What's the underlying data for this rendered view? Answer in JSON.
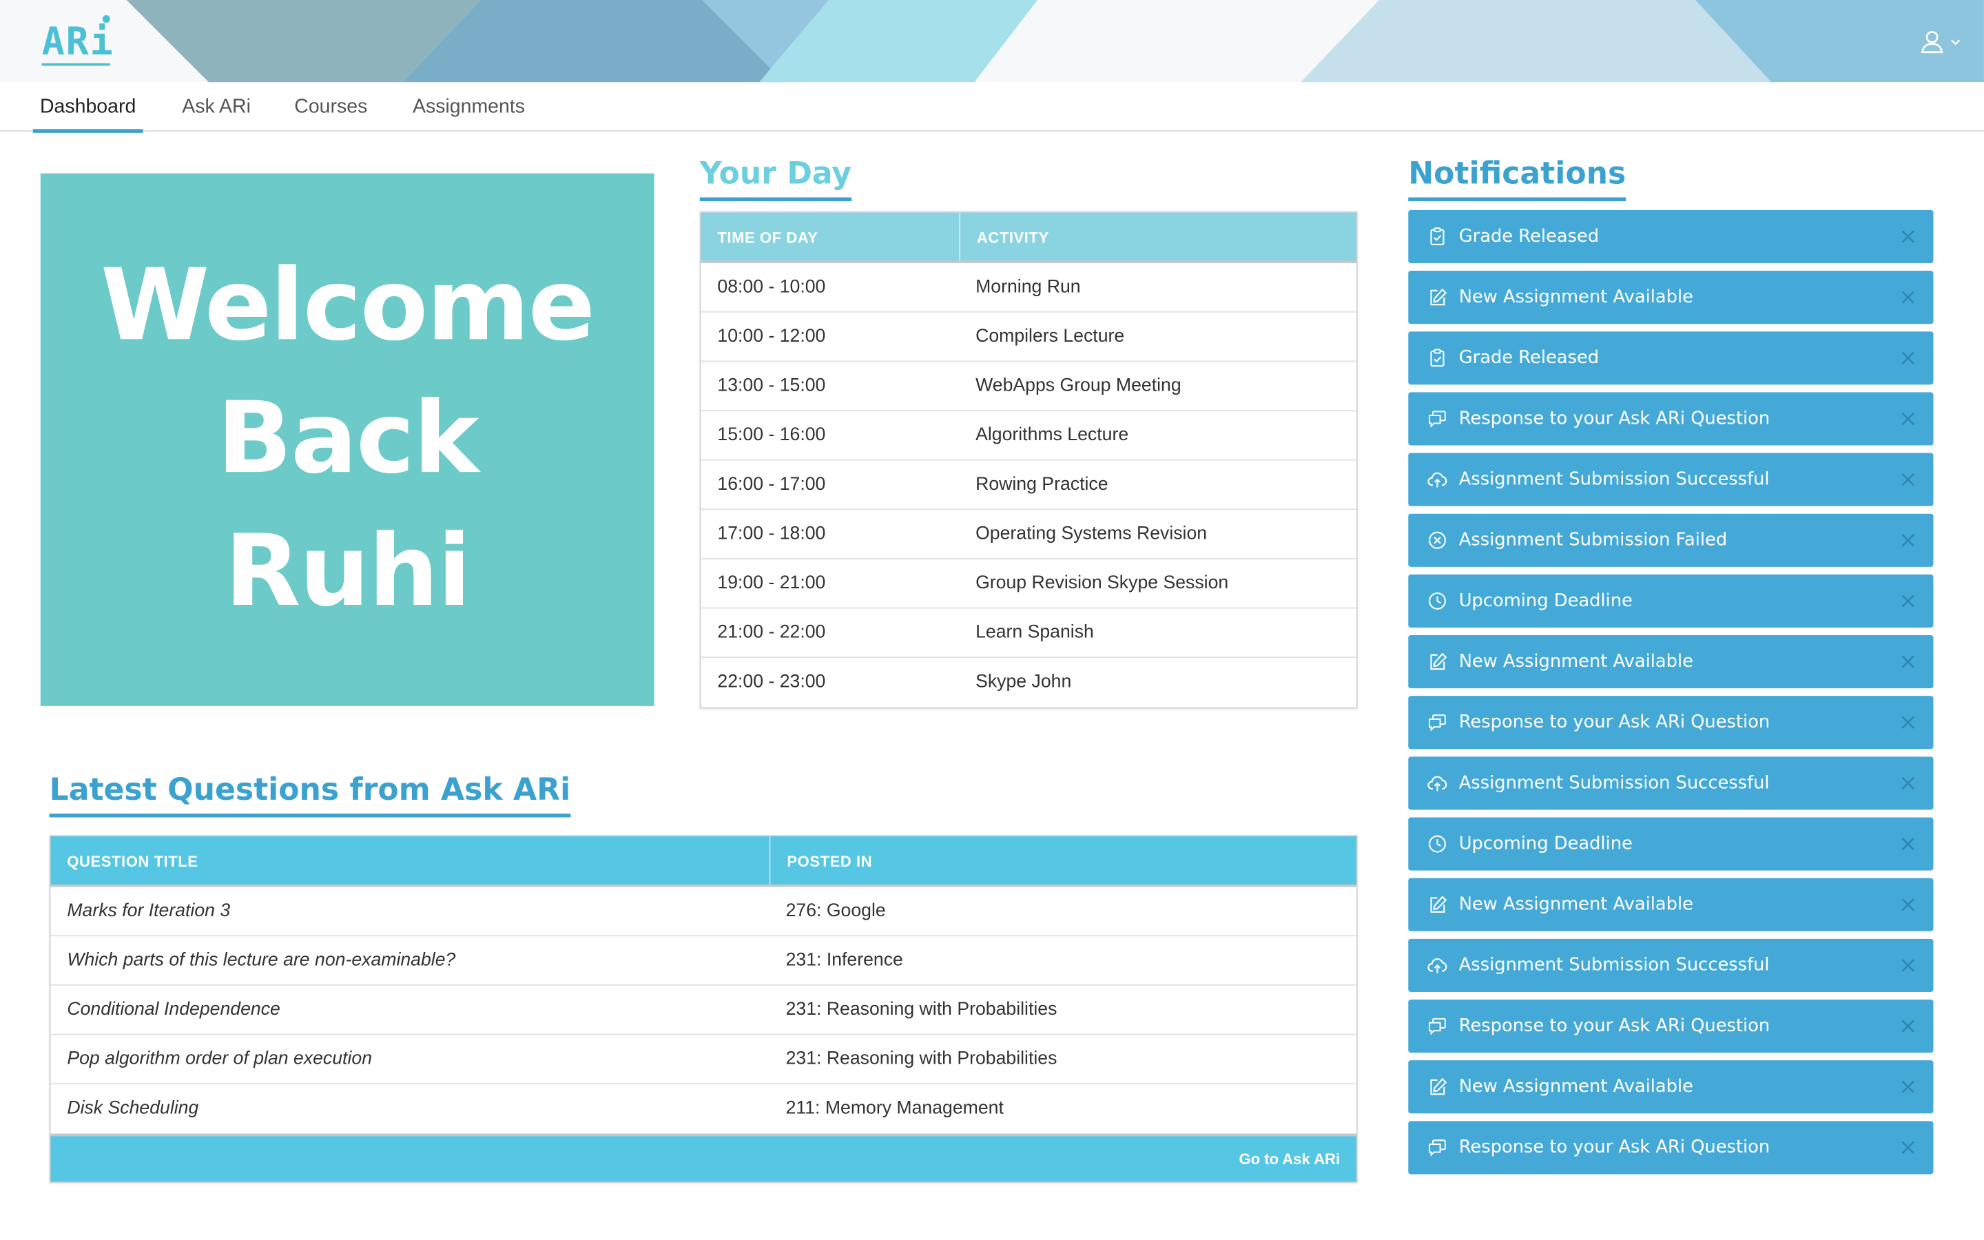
{
  "app": {
    "logo_text": "ARi"
  },
  "nav": {
    "tabs": [
      {
        "label": "Dashboard",
        "active": true
      },
      {
        "label": "Ask ARi",
        "active": false
      },
      {
        "label": "Courses",
        "active": false
      },
      {
        "label": "Assignments",
        "active": false
      }
    ]
  },
  "welcome": {
    "line1": "Welcome",
    "line2": "Back",
    "line3": "Ruhi"
  },
  "your_day": {
    "title": "Your Day",
    "headers": [
      "TIME OF DAY",
      "ACTIVITY"
    ],
    "rows": [
      {
        "time": "08:00 - 10:00",
        "activity": "Morning Run"
      },
      {
        "time": "10:00 - 12:00",
        "activity": "Compilers Lecture"
      },
      {
        "time": "13:00 - 15:00",
        "activity": "WebApps Group Meeting"
      },
      {
        "time": "15:00 - 16:00",
        "activity": "Algorithms Lecture"
      },
      {
        "time": "16:00 - 17:00",
        "activity": "Rowing Practice"
      },
      {
        "time": "17:00 - 18:00",
        "activity": "Operating Systems Revision"
      },
      {
        "time": "19:00 - 21:00",
        "activity": "Group Revision Skype Session"
      },
      {
        "time": "21:00 - 22:00",
        "activity": "Learn Spanish"
      },
      {
        "time": "22:00 - 23:00",
        "activity": "Skype John"
      }
    ]
  },
  "questions": {
    "title": "Latest Questions from Ask ARi",
    "headers": [
      "QUESTION TITLE",
      "POSTED IN"
    ],
    "rows": [
      {
        "title": "Marks for Iteration 3",
        "posted_in": "276: Google"
      },
      {
        "title": "Which parts of this lecture are non-examinable?",
        "posted_in": "231: Inference"
      },
      {
        "title": "Conditional Independence",
        "posted_in": "231: Reasoning with Probabilities"
      },
      {
        "title": "Pop algorithm order of plan execution",
        "posted_in": "231: Reasoning with Probabilities"
      },
      {
        "title": "Disk Scheduling",
        "posted_in": "211: Memory Management"
      }
    ],
    "footer_link": "Go to Ask ARi"
  },
  "notifications": {
    "title": "Notifications",
    "items": [
      {
        "label": "Grade Released",
        "icon": "clipboard-icon"
      },
      {
        "label": "New Assignment Available",
        "icon": "edit-icon"
      },
      {
        "label": "Grade Released",
        "icon": "clipboard-icon"
      },
      {
        "label": "Response to your Ask ARi Question",
        "icon": "chat-icon"
      },
      {
        "label": "Assignment Submission Successful",
        "icon": "cloud-upload-icon"
      },
      {
        "label": "Assignment Submission Failed",
        "icon": "x-circle-icon"
      },
      {
        "label": "Upcoming Deadline",
        "icon": "clock-icon"
      },
      {
        "label": "New Assignment Available",
        "icon": "edit-icon"
      },
      {
        "label": "Response to your Ask ARi Question",
        "icon": "chat-icon"
      },
      {
        "label": "Assignment Submission Successful",
        "icon": "cloud-upload-icon"
      },
      {
        "label": "Upcoming Deadline",
        "icon": "clock-icon"
      },
      {
        "label": "New Assignment Available",
        "icon": "edit-icon"
      },
      {
        "label": "Assignment Submission Successful",
        "icon": "cloud-upload-icon"
      },
      {
        "label": "Response to your Ask ARi Question",
        "icon": "chat-icon"
      },
      {
        "label": "New Assignment Available",
        "icon": "edit-icon"
      },
      {
        "label": "Response to your Ask ARi Question",
        "icon": "chat-icon"
      }
    ]
  },
  "colors": {
    "brand": "#4cc0d4",
    "welcome_bg": "#6ccbc8",
    "notification_bg": "#45a9d8",
    "questions_header": "#55c6e4",
    "day_header": "#8ad4e2",
    "title_blue": "#3ba2cf"
  }
}
